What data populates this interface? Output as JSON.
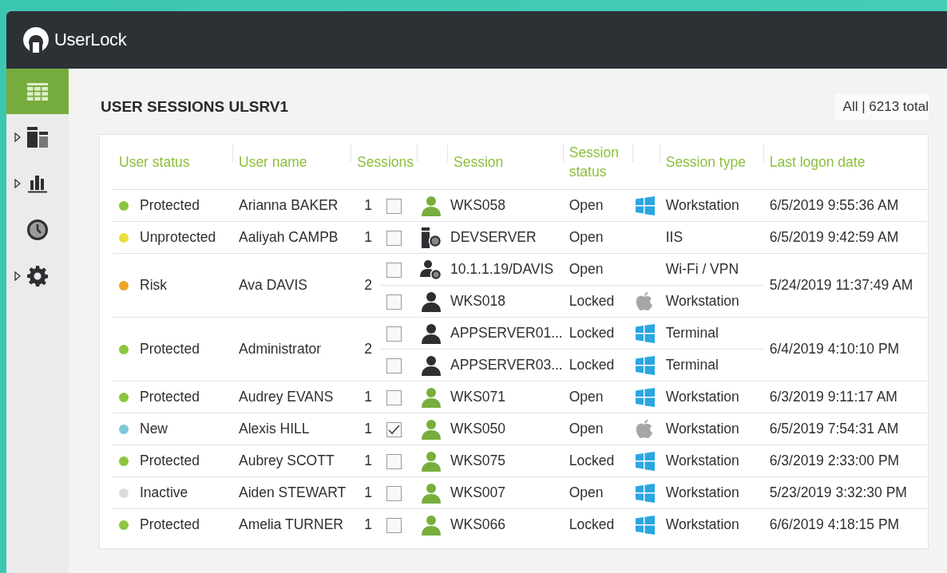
{
  "app": {
    "brand": "UserLock"
  },
  "sidebar": {
    "items": [
      {
        "kind": "sessions",
        "selected": true,
        "expandable": false
      },
      {
        "kind": "dashboard",
        "selected": false,
        "expandable": true
      },
      {
        "kind": "reports",
        "selected": false,
        "expandable": true
      },
      {
        "kind": "history",
        "selected": false,
        "expandable": false
      },
      {
        "kind": "settings",
        "selected": false,
        "expandable": true
      }
    ]
  },
  "page": {
    "title": "USER SESSIONS ULSRV1",
    "summary": "All | 6213 total"
  },
  "table": {
    "columns": [
      "User status",
      "User name",
      "Sessions",
      "Session",
      "Session status",
      "Session type",
      "Last logon date"
    ],
    "rows": [
      {
        "status": "Protected",
        "color": "#8cc63f",
        "user": "Arianna BAKER",
        "count": "1",
        "last_logon": "6/5/2019 9:55:36 AM",
        "sessions": [
          {
            "checked": false,
            "kind": "active",
            "name": "WKS058",
            "state": "Open",
            "platform": {
              "kind": "windows"
            },
            "type": "Workstation"
          }
        ]
      },
      {
        "status": "Unprotected",
        "color": "#e8e03a",
        "user": "Aaliyah CAMPB",
        "count": "1",
        "last_logon": "6/5/2019 9:42:59 AM",
        "sessions": [
          {
            "checked": false,
            "kind": "server",
            "name": "DEVSERVER",
            "state": "Open",
            "type": "IIS"
          }
        ]
      },
      {
        "status": "Risk",
        "color": "#eea326",
        "user": "Ava DAVIS",
        "count": "2",
        "last_logon": "5/24/2019 11:37:49 AM",
        "sessions": [
          {
            "checked": false,
            "kind": "remote",
            "name": "10.1.1.19/DAVIS",
            "state": "Open",
            "type": "Wi-Fi / VPN"
          },
          {
            "checked": false,
            "kind": "user",
            "name": "WKS018",
            "state": "Locked",
            "platform": {
              "kind": "apple"
            },
            "type": "Workstation"
          }
        ]
      },
      {
        "status": "Protected",
        "color": "#8cc63f",
        "user": "Administrator",
        "count": "2",
        "last_logon": "6/4/2019 4:10:10 PM",
        "sessions": [
          {
            "checked": false,
            "kind": "user",
            "name": "APPSERVER01...",
            "state": "Locked",
            "platform": {
              "kind": "windows"
            },
            "type": "Terminal"
          },
          {
            "checked": false,
            "kind": "user",
            "name": "APPSERVER03...",
            "state": "Locked",
            "platform": {
              "kind": "windows"
            },
            "type": "Terminal"
          }
        ]
      },
      {
        "status": "Protected",
        "color": "#8cc63f",
        "user": "Audrey EVANS",
        "count": "1",
        "last_logon": "6/3/2019 9:11:17 AM",
        "sessions": [
          {
            "checked": false,
            "kind": "active",
            "name": "WKS071",
            "state": "Open",
            "platform": {
              "kind": "windows"
            },
            "type": "Workstation"
          }
        ]
      },
      {
        "status": "New",
        "color": "#7ec6d6",
        "user": "Alexis HILL",
        "count": "1",
        "last_logon": "6/5/2019 7:54:31 AM",
        "sessions": [
          {
            "checked": true,
            "kind": "active",
            "name": "WKS050",
            "state": "Open",
            "platform": {
              "kind": "apple"
            },
            "type": "Workstation"
          }
        ]
      },
      {
        "status": "Protected",
        "color": "#8cc63f",
        "user": "Aubrey SCOTT",
        "count": "1",
        "last_logon": "6/3/2019 2:33:00 PM",
        "sessions": [
          {
            "checked": false,
            "kind": "active",
            "name": "WKS075",
            "state": "Locked",
            "platform": {
              "kind": "windows"
            },
            "type": "Workstation"
          }
        ]
      },
      {
        "status": "Inactive",
        "color": "#dddddd",
        "user": "Aiden STEWART",
        "count": "1",
        "last_logon": "5/23/2019 3:32:30 PM",
        "sessions": [
          {
            "checked": false,
            "kind": "active",
            "name": "WKS007",
            "state": "Open",
            "platform": {
              "kind": "windows"
            },
            "type": "Workstation"
          }
        ]
      },
      {
        "status": "Protected",
        "color": "#8cc63f",
        "user": "Amelia TURNER",
        "count": "1",
        "last_logon": "6/6/2019 4:18:15 PM",
        "sessions": [
          {
            "checked": false,
            "kind": "active",
            "name": "WKS066",
            "state": "Locked",
            "platform": {
              "kind": "windows"
            },
            "type": "Workstation"
          }
        ]
      }
    ]
  }
}
